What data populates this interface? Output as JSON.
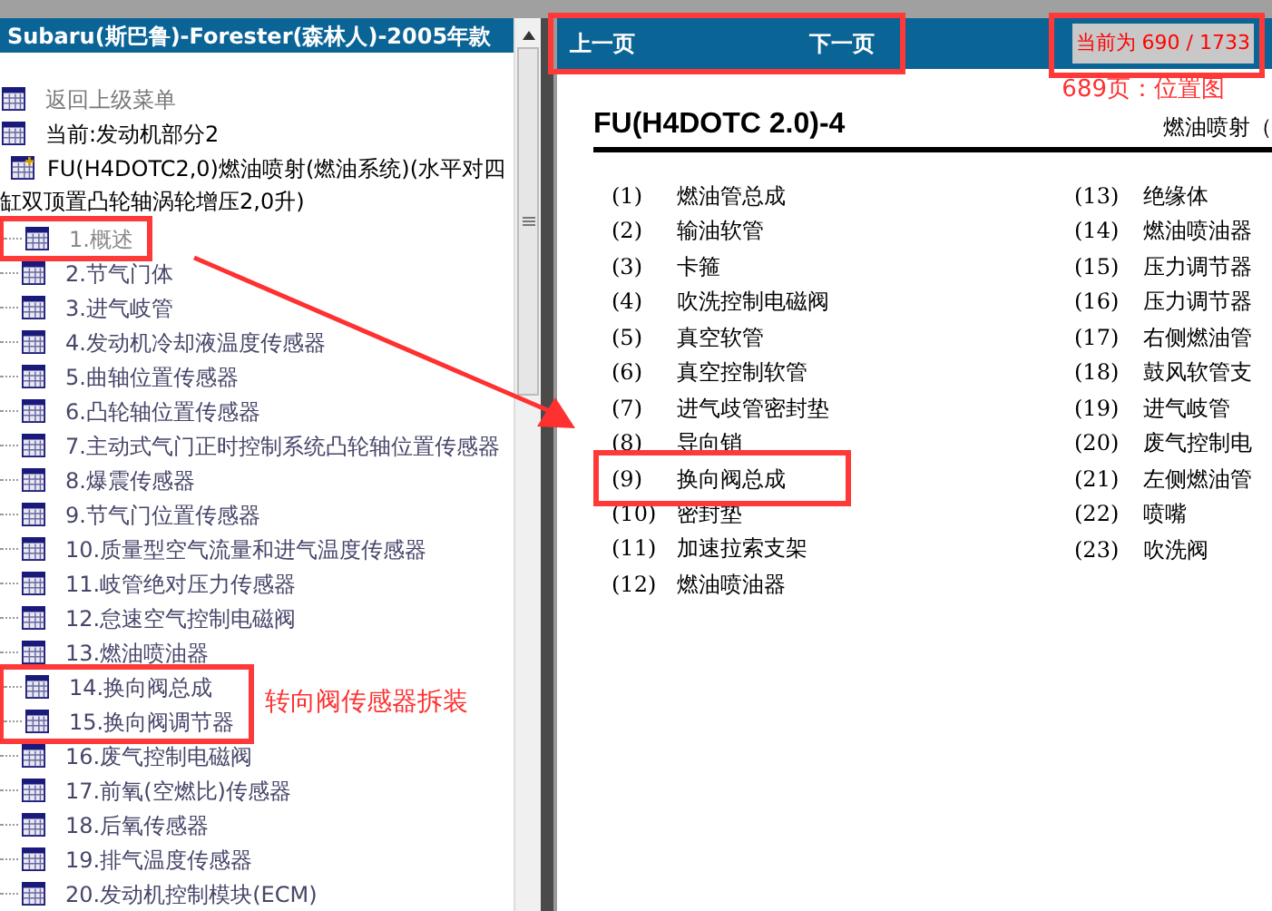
{
  "sidebar": {
    "title": "Subaru(斯巴鲁)-Forester(森林人)-2005年款",
    "items": [
      {
        "kind": "back",
        "label": "返回上级菜单"
      },
      {
        "kind": "current",
        "label": "当前:发动机部分2"
      },
      {
        "kind": "folder",
        "label": "FU(H4DOTC2,0)燃油喷射(燃油系统)(水平对四缸双顶置凸轮轴涡轮增压2,0升)",
        "children": [
          {
            "label": "1.概述",
            "visited": true,
            "highlighted": true
          },
          {
            "label": "2.节气门体",
            "visited": false,
            "highlighted": false
          },
          {
            "label": "3.进气岐管",
            "visited": false,
            "highlighted": false
          },
          {
            "label": "4.发动机冷却液温度传感器",
            "visited": false,
            "highlighted": false
          },
          {
            "label": "5.曲轴位置传感器",
            "visited": false,
            "highlighted": false
          },
          {
            "label": "6.凸轮轴位置传感器",
            "visited": false,
            "highlighted": false
          },
          {
            "label": "7.主动式气门正时控制系统凸轮轴位置传感器",
            "visited": false,
            "highlighted": false
          },
          {
            "label": "8.爆震传感器",
            "visited": false,
            "highlighted": false
          },
          {
            "label": "9.节气门位置传感器",
            "visited": false,
            "highlighted": false
          },
          {
            "label": "10.质量型空气流量和进气温度传感器",
            "visited": false,
            "highlighted": false
          },
          {
            "label": "11.岐管绝对压力传感器",
            "visited": false,
            "highlighted": false
          },
          {
            "label": "12.怠速空气控制电磁阀",
            "visited": false,
            "highlighted": false
          },
          {
            "label": "13.燃油喷油器",
            "visited": false,
            "highlighted": false
          },
          {
            "label": "14.换向阀总成",
            "visited": false,
            "highlighted": true
          },
          {
            "label": "15.换向阀调节器",
            "visited": false,
            "highlighted": true
          },
          {
            "label": "16.废气控制电磁阀",
            "visited": false,
            "highlighted": false
          },
          {
            "label": "17.前氧(空燃比)传感器",
            "visited": false,
            "highlighted": false
          },
          {
            "label": "18.后氧传感器",
            "visited": false,
            "highlighted": false
          },
          {
            "label": "19.排气温度传感器",
            "visited": false,
            "highlighted": false
          },
          {
            "label": "20.发动机控制模块(ECM)",
            "visited": false,
            "highlighted": false
          }
        ]
      }
    ]
  },
  "nav": {
    "prev": "上一页",
    "next": "下一页",
    "position": "当前为 690 / 1733",
    "buttons_highlighted": true,
    "position_highlighted": true
  },
  "document": {
    "title": "FU(H4DOTC 2.0)-4",
    "section": "燃油喷射（",
    "left_parts": [
      {
        "num": "(1)",
        "name": "燃油管总成",
        "highlighted": false
      },
      {
        "num": "(2)",
        "name": "输油软管",
        "highlighted": false
      },
      {
        "num": "(3)",
        "name": "卡箍",
        "highlighted": false
      },
      {
        "num": "(4)",
        "name": "吹洗控制电磁阀",
        "highlighted": false
      },
      {
        "num": "(5)",
        "name": "真空软管",
        "highlighted": false
      },
      {
        "num": "(6)",
        "name": "真空控制软管",
        "highlighted": false
      },
      {
        "num": "(7)",
        "name": "进气歧管密封垫",
        "highlighted": false
      },
      {
        "num": "(8)",
        "name": "导向销",
        "highlighted": false
      },
      {
        "num": "(9)",
        "name": "换向阀总成",
        "highlighted": true
      },
      {
        "num": "(10)",
        "name": "密封垫",
        "highlighted": false
      },
      {
        "num": "(11)",
        "name": "加速拉索支架",
        "highlighted": false
      },
      {
        "num": "(12)",
        "name": "燃油喷油器",
        "highlighted": false
      }
    ],
    "right_parts": [
      {
        "num": "(13)",
        "name": "绝缘体"
      },
      {
        "num": "(14)",
        "name": "燃油喷油器"
      },
      {
        "num": "(15)",
        "name": "压力调节器"
      },
      {
        "num": "(16)",
        "name": "压力调节器"
      },
      {
        "num": "(17)",
        "name": "右侧燃油管"
      },
      {
        "num": "(18)",
        "name": "鼓风软管支"
      },
      {
        "num": "(19)",
        "name": "进气岐管"
      },
      {
        "num": "(20)",
        "name": "废气控制电"
      },
      {
        "num": "(21)",
        "name": "左侧燃油管"
      },
      {
        "num": "(22)",
        "name": "喷嘴"
      },
      {
        "num": "(23)",
        "name": "吹洗阀"
      }
    ]
  },
  "annotations": {
    "sidebar_note": "转向阀传感器拆装",
    "page_note": "689页：位置图"
  }
}
